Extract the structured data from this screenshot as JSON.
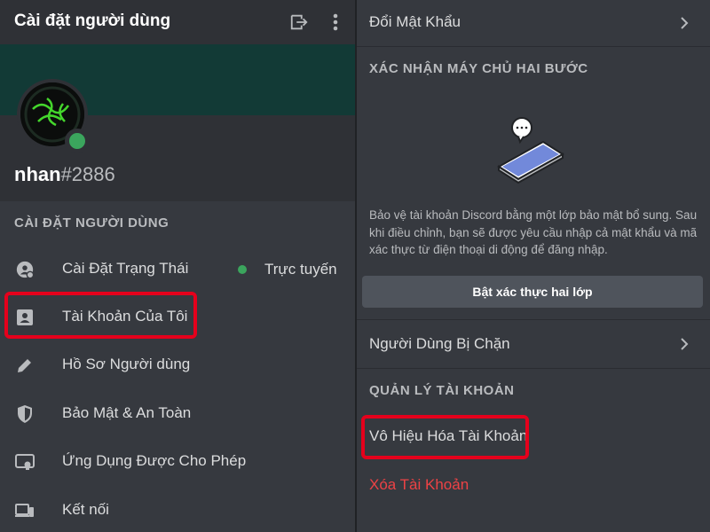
{
  "left": {
    "title": "Cài đặt người dùng",
    "icons": {
      "logout": "logout-icon",
      "more": "more-vertical-icon"
    },
    "colors": {
      "banner": "#123a36",
      "status_online": "#3ba55d",
      "highlight": "#e5001c"
    },
    "user": {
      "name": "nhan",
      "discriminator": "#2886"
    },
    "section_header": "CÀI ĐẶT NGƯỜI DÙNG",
    "items": [
      {
        "label": "Cài Đặt Trạng Thái",
        "icon": "status-icon",
        "status": "Trực tuyến"
      },
      {
        "label": "Tài Khoản Của Tôi",
        "icon": "account-card-icon"
      },
      {
        "label": "Hồ Sơ Người dùng",
        "icon": "pencil-icon"
      },
      {
        "label": "Bảo Mật & An Toàn",
        "icon": "shield-icon"
      },
      {
        "label": "Ứng Dụng Được Cho Phép",
        "icon": "authorized-apps-icon"
      },
      {
        "label": "Kết nối",
        "icon": "devices-icon"
      }
    ]
  },
  "right": {
    "change_password": "Đổi Mật Khẩu",
    "twofa_header": "XÁC NHẬN MÁY CHỦ HAI BƯỚC",
    "twofa_desc": "Bảo vệ tài khoản Discord bằng một lớp bảo mật bổ sung. Sau khi điều chỉnh, bạn sẽ được yêu cầu nhập cả mật khẩu và mã xác thực từ điện thoại di động để đăng nhập.",
    "enable_2fa": "Bật xác thực hai lớp",
    "blocked_users": "Người Dùng Bị Chặn",
    "account_mgmt_header": "QUẢN LÝ TÀI KHOẢN",
    "disable_account": "Vô Hiệu Hóa Tài Khoản",
    "delete_account": "Xóa Tài Khoản",
    "colors": {
      "danger": "#ed4245",
      "button": "#4f545c"
    }
  }
}
